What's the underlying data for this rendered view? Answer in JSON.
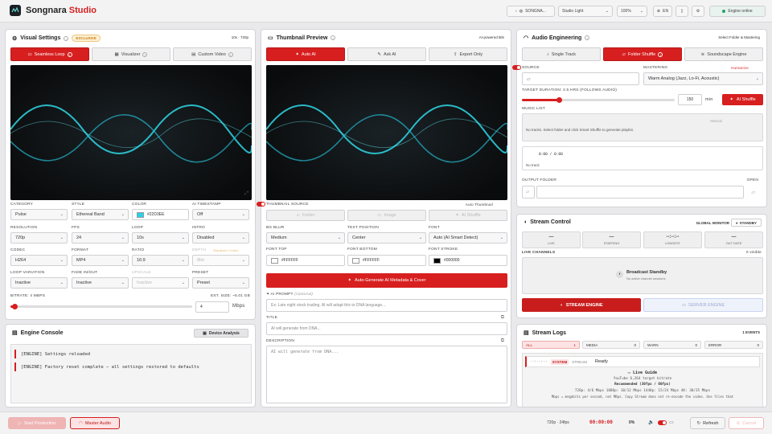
{
  "app": {
    "name_part1": "Songnara",
    "name_part2": "Studio"
  },
  "topbar": {
    "user": "SONGNA...",
    "theme": "Studio Light",
    "zoom": "100%",
    "language": "EN",
    "engine_status": "Engine online"
  },
  "visual": {
    "title": "Visual Settings",
    "badge": "EXCLUSIVE",
    "resolution_note": "10s · 720p",
    "tabs": [
      "Seamless Loop",
      "Visualizer",
      "Custom Video"
    ],
    "fields": [
      {
        "label": "CATEGORY",
        "value": "Pulse"
      },
      {
        "label": "STYLE",
        "value": "Ethereal Band"
      },
      {
        "label": "COLOR",
        "value": "#22D3EE"
      },
      {
        "label": "AI TIMESTAMP",
        "value": "Off"
      },
      {
        "label": "RESOLUTION",
        "value": "720p"
      },
      {
        "label": "FPS",
        "value": "24"
      },
      {
        "label": "LOOP",
        "value": "10s"
      },
      {
        "label": "INTRO",
        "value": "Disabled"
      },
      {
        "label": "CODEC",
        "value": "H264"
      },
      {
        "label": "FORMAT",
        "value": "MP4"
      },
      {
        "label": "RATIO",
        "value": "16:9"
      },
      {
        "label": "DEPTH",
        "value": "8bit"
      },
      {
        "label": "LOOP VARIATION",
        "value": "Inactive"
      },
      {
        "label": "FADE IN/OUT",
        "value": "Inactive"
      },
      {
        "label": "UPSCALE",
        "value": "Inactive"
      },
      {
        "label": "PRESET",
        "value": "Preset"
      }
    ],
    "depth_extra": "Standard Codec",
    "bitrate_label": "BITRATE: 4 MBPS",
    "est_size": "EST. SIZE: ~5.01 GB",
    "bitrate_value": "4",
    "bitrate_unit": "Mbps",
    "bitrate_fraction": 0.02
  },
  "console": {
    "title": "Engine Console",
    "button": "Device Analysis",
    "lines": [
      "[ENGINE] Settings reloaded",
      "[ENGINE] Factory reset complete — all settings restored to defaults"
    ]
  },
  "thumb": {
    "title": "Thumbnail Preview",
    "note": "AI-powered title",
    "tabs": [
      "Auto AI",
      "Ask AI",
      "Export Only"
    ],
    "source_label": "THUMBNAIL SOURCE",
    "auto_label": "Auto Thumbnail",
    "source_buttons": [
      "Folder",
      "Image",
      "AI Shuffle"
    ],
    "bg_blur_label": "BG BLUR",
    "bg_blur": "Medium",
    "text_pos_label": "TEXT POSITION",
    "text_pos": "Center",
    "font_label": "FONT",
    "font": "Auto (AI Smart Detect)",
    "font_top_label": "FONT TOP",
    "font_top": "#FFFFFF",
    "font_bottom_label": "FONT BOTTOM",
    "font_bottom": "#FFFFFF",
    "font_stroke_label": "FONT STROKE",
    "font_stroke": "#000000",
    "generate": "Auto-Generate AI Metadata & Cover",
    "prompt_label": "AI PROMPT",
    "prompt_opt": "(Optional)",
    "prompt_ph": "Ex: Late night stock trading. AI will adapt this to DNA language...",
    "title_label": "TITLE",
    "title_ph": "AI will generate from DNA...",
    "desc_label": "DESCRIPTION",
    "desc_ph": "AI will generate from DNA..."
  },
  "audio": {
    "title": "Audio Engineering",
    "note": "Select Folder & Mastering",
    "tabs": [
      "Single Track",
      "Folder Shuffle",
      "Soundscape Engine"
    ],
    "source_label": "SOURCE",
    "mastering_label": "MASTERING",
    "humanize": "Humanize",
    "mastering": "Warm Analog (Jazz, Lo-Fi, Acoustic)",
    "duration_label": "TARGET DURATION: 2.5 HRS (FOLLOWS AUDIO)",
    "duration_value": "150",
    "duration_unit": "min",
    "duration_fraction": 0.24,
    "shuffle_btn": "AI Shuffle",
    "list_label": "MUSIC LIST",
    "list_mode": "Manual",
    "list_empty": "No tracks. Select folder and click Smart Shuffle to generate playlist.",
    "time": "0:00 / 0:00",
    "no_track": "No track",
    "output_label": "OUTPUT FOLDER",
    "open": "OPEN"
  },
  "stream": {
    "title": "Stream Control",
    "monitor_label": "GLOBAL MONITOR",
    "monitor_state": "STANDBY",
    "stats": [
      {
        "value": "—",
        "label": "LIVE"
      },
      {
        "value": "—",
        "label": "STARTING"
      },
      {
        "value": "--:--:--",
        "label": "LONGEST"
      },
      {
        "value": "—",
        "label": "OUT DATE"
      }
    ],
    "channels_label": "LIVE CHANNELS",
    "visible": "0 visible",
    "standby_title": "Broadcast Standby",
    "standby_sub": "No active channel sessions",
    "engine_btn": "STREAM ENGINE",
    "server_btn": "SERVER ENGINE"
  },
  "logs": {
    "title": "Stream Logs",
    "events": "1 EVENTS",
    "filters": [
      {
        "name": "ALL",
        "count": "1"
      },
      {
        "name": "MEDIA",
        "count": "0"
      },
      {
        "name": "WARN",
        "count": "0"
      },
      {
        "name": "ERROR",
        "count": "0"
      }
    ],
    "entry_time": "--:--:--",
    "entry_tag1": "SYSTEM",
    "entry_tag2": "STREAM",
    "entry_text": "Ready",
    "guide_title": "Live Guide",
    "guide_sub": "YouTube 6,264 target bitrate",
    "guide_rec": "Recommended (30fps / 60fps)",
    "guide_rates": "720p: 4/6 Mbps   1080p: 10/12 Mbps   1440p: 15/24 Mbps   4K: 30/35 Mbps",
    "guide_note": "Mbps = megabits per second, not MBps. Copy Stream does not re-encode the video. Use files that"
  },
  "bottom": {
    "start": "Start Production",
    "master": "Master Audio",
    "info": "720p · 24fps",
    "timer": "00:00:00",
    "percent": "0%",
    "refresh": "Refresh",
    "cancel": "Cancel"
  },
  "colors": {
    "accent": "#D71F1F",
    "wave": "#22D3EE"
  }
}
